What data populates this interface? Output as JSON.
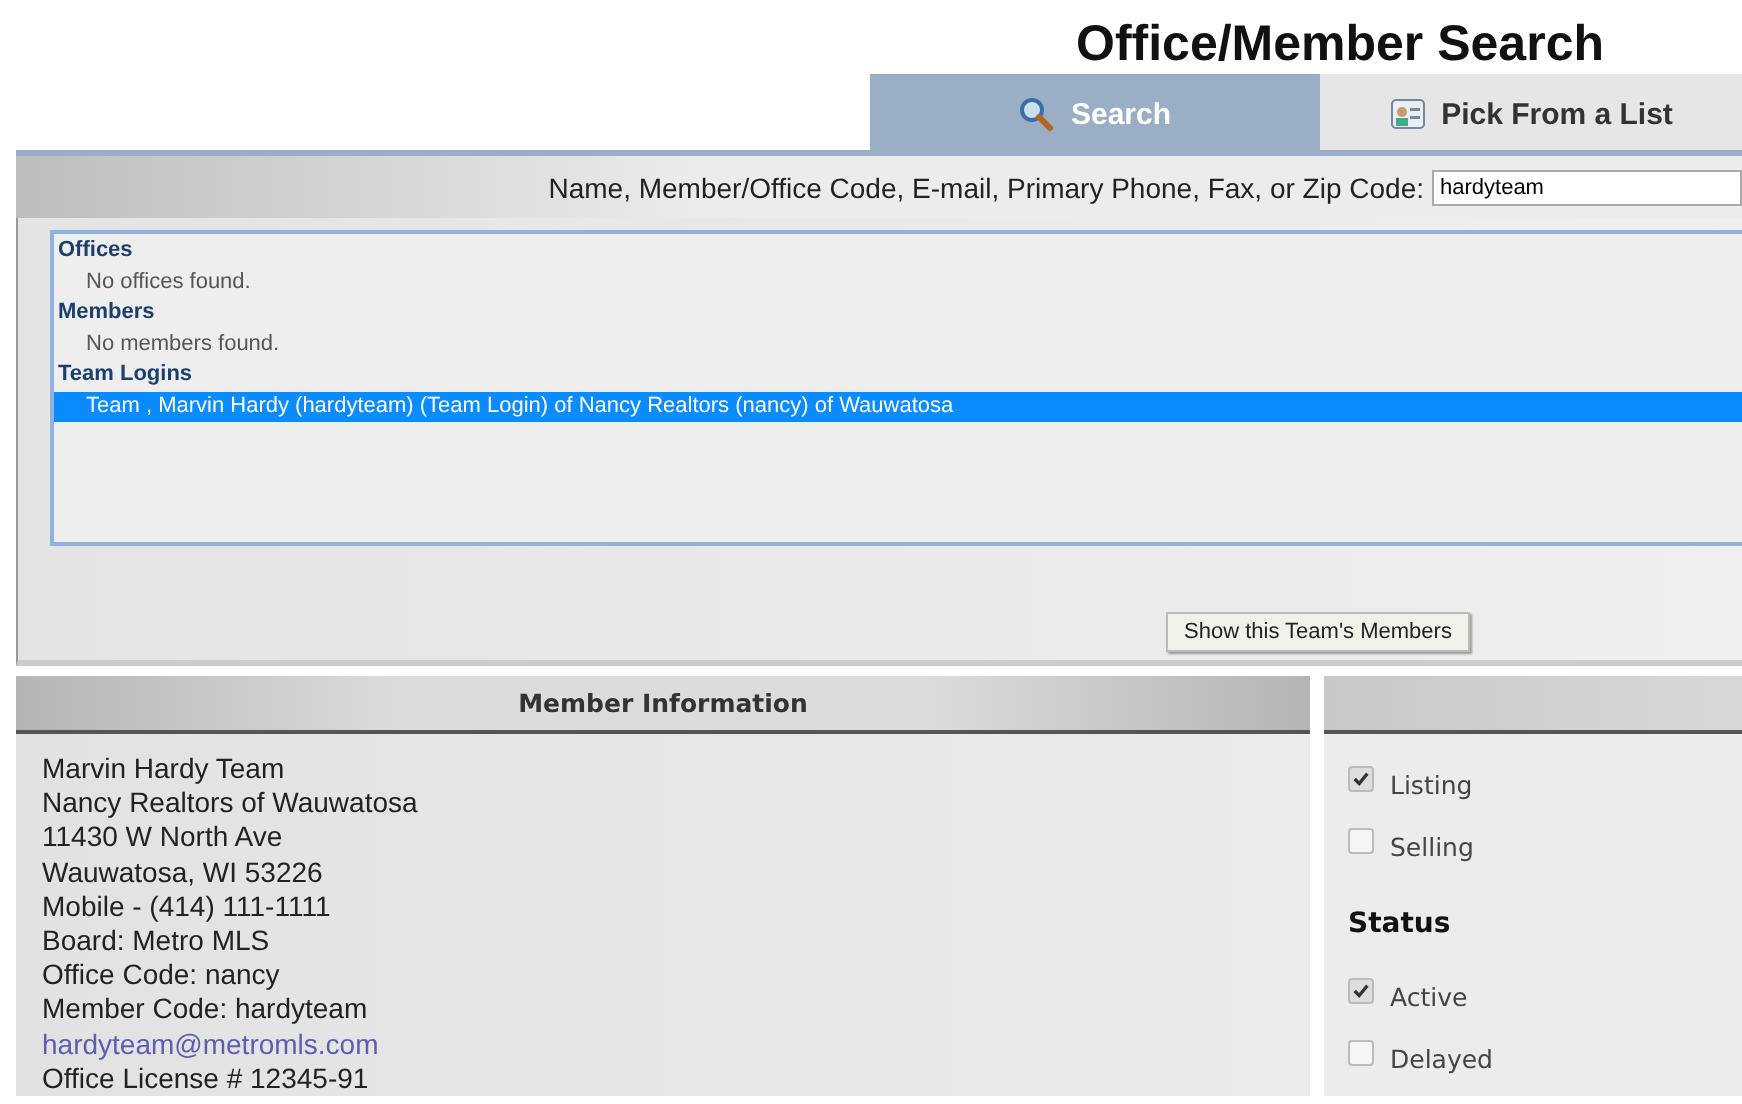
{
  "title": "Office/Member Search",
  "tabs": [
    {
      "label": "Search",
      "kind": "search",
      "selected": true
    },
    {
      "label": "Pick From a List",
      "kind": "list",
      "selected": false
    }
  ],
  "search": {
    "label": "Name, Member/Office Code, E-mail, Primary Phone, Fax, or Zip Code:",
    "value": "hardyteam"
  },
  "results": [
    {
      "heading": "Offices",
      "items": [
        {
          "text": "No offices found.",
          "selected": false
        }
      ]
    },
    {
      "heading": "Members",
      "items": [
        {
          "text": "No members found.",
          "selected": false
        }
      ]
    },
    {
      "heading": "Team Logins",
      "items": [
        {
          "text": "Team , Marvin Hardy (hardyteam) (Team Login) of Nancy Realtors (nancy) of Wauwatosa",
          "selected": true
        }
      ]
    }
  ],
  "show_members_button": "Show this Team's Members",
  "member_info": {
    "title": "Member Information",
    "lines": [
      {
        "kind": "text",
        "text": "Marvin Hardy Team"
      },
      {
        "kind": "text",
        "text": "Nancy Realtors of Wauwatosa"
      },
      {
        "kind": "text",
        "text": "11430 W North Ave"
      },
      {
        "kind": "text",
        "text": "Wauwatosa, WI 53226"
      },
      {
        "kind": "text",
        "text": "Mobile - (414) 111-1111"
      },
      {
        "kind": "text",
        "text": "Board: Metro MLS"
      },
      {
        "kind": "text",
        "text": "Office Code: nancy"
      },
      {
        "kind": "text",
        "text": "Member Code: hardyteam"
      },
      {
        "kind": "link",
        "text": "hardyteam@metromls.com"
      },
      {
        "kind": "text",
        "text": "Office License # 12345-91"
      }
    ]
  },
  "options": [
    {
      "kind": "checkbox",
      "label": "Listing",
      "checked": true
    },
    {
      "kind": "checkbox",
      "label": "Selling",
      "checked": false
    },
    {
      "kind": "heading",
      "label": "Status"
    },
    {
      "kind": "checkbox",
      "label": "Active",
      "checked": true
    },
    {
      "kind": "checkbox",
      "label": "Delayed",
      "checked": false
    }
  ]
}
